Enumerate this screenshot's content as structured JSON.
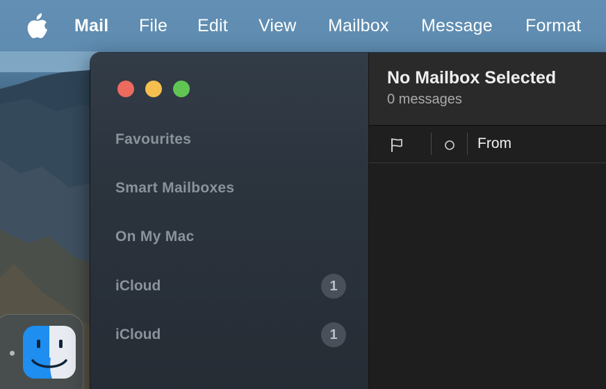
{
  "menubar": {
    "app_name": "Mail",
    "items": [
      "File",
      "Edit",
      "View",
      "Mailbox",
      "Message",
      "Format"
    ]
  },
  "sidebar": {
    "sections": [
      "Favourites",
      "Smart Mailboxes",
      "On My Mac"
    ],
    "accounts": [
      {
        "label": "iCloud",
        "badge": "1"
      },
      {
        "label": "iCloud",
        "badge": "1"
      }
    ]
  },
  "content": {
    "title": "No Mailbox Selected",
    "subtitle": "0 messages",
    "columns": {
      "flag_icon": "flag-icon",
      "unread_icon": "unread-dot-icon",
      "from_label": "From"
    }
  },
  "window_controls": {
    "close_color": "#ed6a5e",
    "minimize_color": "#f5bf4f",
    "zoom_color": "#61c554"
  },
  "dock": {
    "apps": [
      "finder-icon"
    ]
  }
}
